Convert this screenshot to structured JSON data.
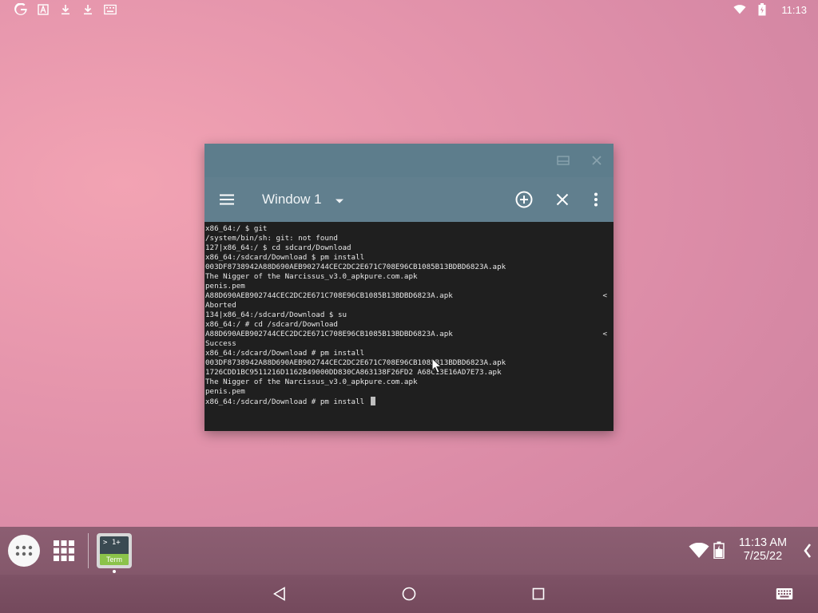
{
  "status_bar": {
    "left_icons": [
      "google-icon",
      "text-a-icon",
      "download-icon",
      "download-icon",
      "keyboard-icon"
    ],
    "right_icons": [
      "wifi-icon",
      "battery-icon"
    ],
    "clock": "11:13"
  },
  "window": {
    "caption_buttons": [
      "restore-icon",
      "close-icon"
    ],
    "toolbar": {
      "menu_icon": "hamburger-menu-icon",
      "selected_window": "Window 1",
      "add_icon": "add-circle-icon",
      "close_icon": "close-icon",
      "more_icon": "more-vert-icon"
    },
    "terminal": {
      "lines": [
        "x86_64:/ $ git",
        "/system/bin/sh: git: not found",
        "127|x86_64:/ $ cd sdcard/Download",
        "x86_64:/sdcard/Download $ pm install",
        "003DF8738942A88D690AEB902744CEC2DC2E671C708E96CB1085B13BDBD6823A.apk",
        "The Nigger of the Narcissus_v3.0_apkpure.com.apk",
        "penis.pem",
        "A88D690AEB902744CEC2DC2E671C708E96CB1085B13BDBD6823A.apk",
        "Aborted",
        "134|x86_64:/sdcard/Download $ su",
        "x86_64:/ # cd /sdcard/Download",
        "A88D690AEB902744CEC2DC2E671C708E96CB1085B13BDBD6823A.apk",
        "Success",
        "x86_64:/sdcard/Download # pm install",
        "003DF8738942A88D690AEB902744CEC2DC2E671C708E96CB1085B13BDBD6823A.apk",
        "1726CDD1BC9511216D1162B49000DD830CA863138F26FD2 A68C13E16AD7E73.apk",
        "The Nigger of the Narcissus_v3.0_apkpure.com.apk",
        "penis.pem",
        "x86_64:/sdcard/Download # pm install "
      ],
      "truncation_marker": "<"
    }
  },
  "taskbar": {
    "app_drawer_icon": "app-drawer-icon",
    "grid_icon": "grid-icon",
    "terminal_app": {
      "top": "> 1+",
      "bottom": "Term"
    },
    "tray_time": "11:13 AM",
    "tray_date": "7/25/22",
    "chevron_icon": "chevron-left-icon"
  },
  "navbar": {
    "buttons": [
      "back-icon",
      "home-icon",
      "recents-icon",
      "keyboard-icon"
    ]
  }
}
